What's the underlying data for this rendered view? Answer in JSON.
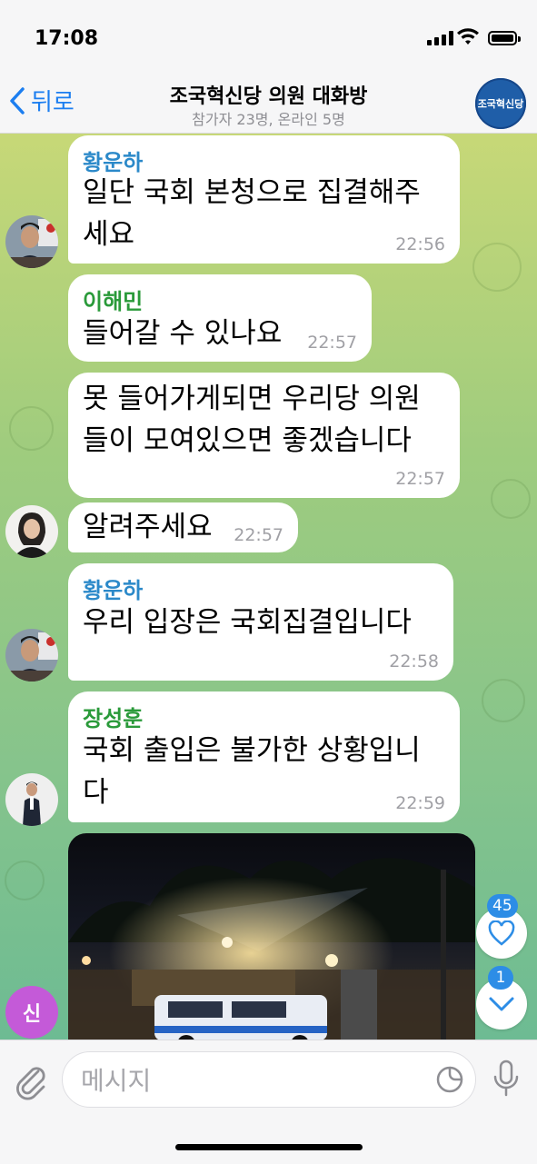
{
  "status": {
    "time": "17:08"
  },
  "header": {
    "back_label": "뒤로",
    "title": "조국혁신당 의원 대화방",
    "subtitle": "참가자 23명, 온라인 5명",
    "avatar_text": "조국혁신당"
  },
  "messages": [
    {
      "sender": "황운하",
      "sender_color": "#2b89c9",
      "text": "일단 국회 본청으로 집결해주\n세요",
      "time": "22:56"
    },
    {
      "sender": "이해민",
      "sender_color": "#2a9a3a",
      "text": "들어갈 수 있나요",
      "time": "22:57"
    },
    {
      "sender": "",
      "text": "못 들어가게되면 우리당 의원\n들이 모여있으면 좋겠습니다",
      "time": "22:57"
    },
    {
      "sender": "",
      "text": "알려주세요",
      "time": "22:57"
    },
    {
      "sender": "황운하",
      "sender_color": "#2b89c9",
      "text": "우리 입장은 국회집결입니다",
      "time": "22:58"
    },
    {
      "sender": "장성훈",
      "sender_color": "#2a9a3a",
      "text": "국회 출입은 불가한 상황입니\n다",
      "time": "22:59"
    }
  ],
  "side": {
    "reactions_count": "45",
    "unread_count": "1"
  },
  "me_avatar": "신",
  "input": {
    "placeholder": "메시지"
  }
}
